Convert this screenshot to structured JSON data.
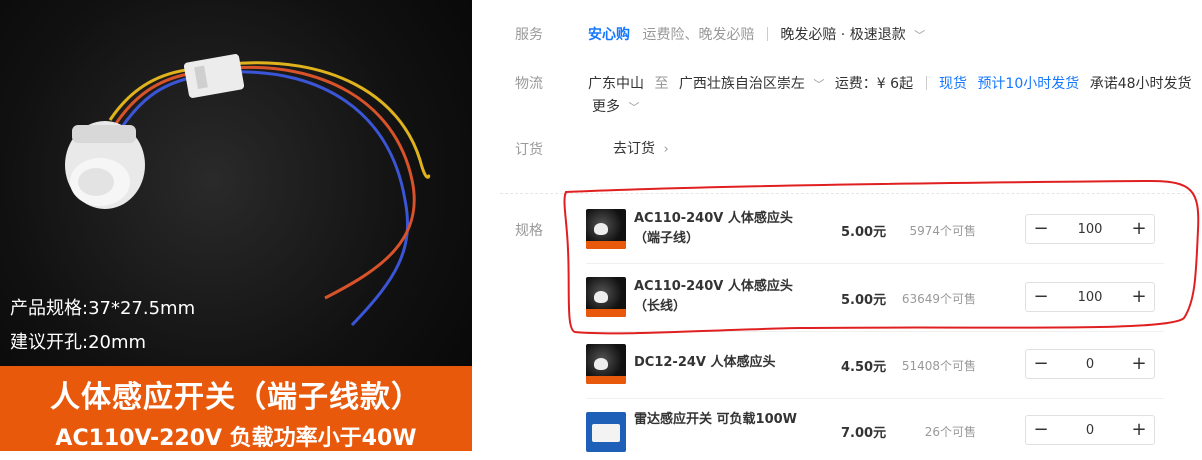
{
  "product_image": {
    "spec_size": "产品规格:37*27.5mm",
    "spec_hole": "建议开孔:20mm",
    "banner_title": "人体感应开关（端子线款）",
    "banner_subtitle": "AC110V-220V  负载功率小于40W"
  },
  "labels": {
    "service": "服务",
    "logistics": "物流",
    "order": "订货",
    "spec": "规格"
  },
  "service": {
    "badge": "安心购",
    "items": "运费险、晚发必赔",
    "promise": "晚发必赔 · 极速退款"
  },
  "logistics": {
    "from": "广东中山",
    "to_word": "至",
    "to": "广西壮族自治区崇左",
    "shipping": "运费：¥ 6起",
    "stock": "现货",
    "ship_time": "预计10小时发货",
    "promise": "承诺48小时发货",
    "more": "更多"
  },
  "order": {
    "link": "去订货"
  },
  "specs": [
    {
      "name": "AC110-240V 人体感应头（端子线）",
      "price": "5.00元",
      "stock": "5974个可售",
      "qty": "100",
      "thumb": "sensor-photo"
    },
    {
      "name": "AC110-240V 人体感应头（长线）",
      "price": "5.00元",
      "stock": "63649个可售",
      "qty": "100",
      "thumb": "sensor-photo"
    },
    {
      "name": "DC12-24V 人体感应头",
      "price": "4.50元",
      "stock": "51408个可售",
      "qty": "0",
      "thumb": "sensor-photo"
    },
    {
      "name": "雷达感应开关 可负载100W",
      "price": "7.00元",
      "stock": "26个可售",
      "qty": "0",
      "thumb": "radar-photo"
    }
  ],
  "stepper_symbols": {
    "minus": "−",
    "plus": "+"
  },
  "colors": {
    "accent_blue": "#1677ff",
    "banner_orange": "#e8590c",
    "annotation_red": "#e02020"
  }
}
